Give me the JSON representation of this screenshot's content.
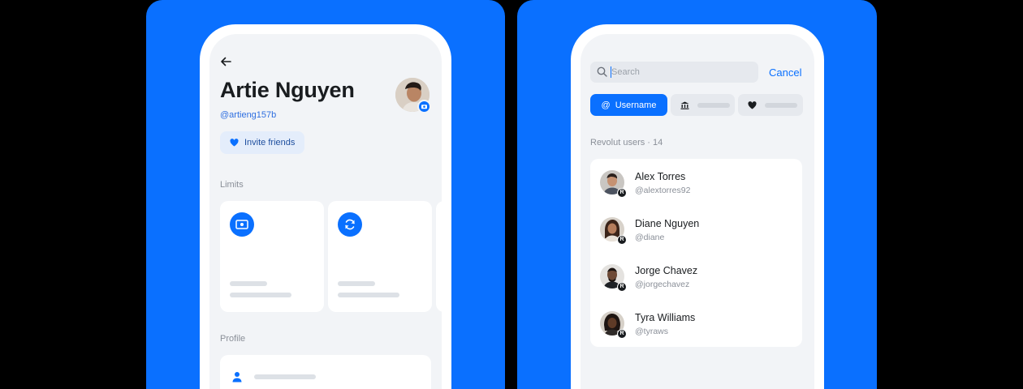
{
  "left_screen": {
    "profile_name": "Artie Nguyen",
    "username": "@artieng157b",
    "invite_label": "Invite friends",
    "limits_label": "Limits",
    "profile_label": "Profile"
  },
  "right_screen": {
    "search_placeholder": "Search",
    "cancel_label": "Cancel",
    "chips": {
      "username_label": "Username"
    },
    "list_header": "Revolut users · 14",
    "users": [
      {
        "name": "Alex Torres",
        "handle": "@alextorres92"
      },
      {
        "name": "Diane Nguyen",
        "handle": "@diane"
      },
      {
        "name": "Jorge Chavez",
        "handle": "@jorgechavez"
      },
      {
        "name": "Tyra Williams",
        "handle": "@tyraws"
      }
    ],
    "badge_letter": "R"
  },
  "colors": {
    "accent": "#0a70ff",
    "background": "#f2f4f7",
    "text_primary": "#191c1f",
    "text_secondary": "#8a8f98"
  }
}
